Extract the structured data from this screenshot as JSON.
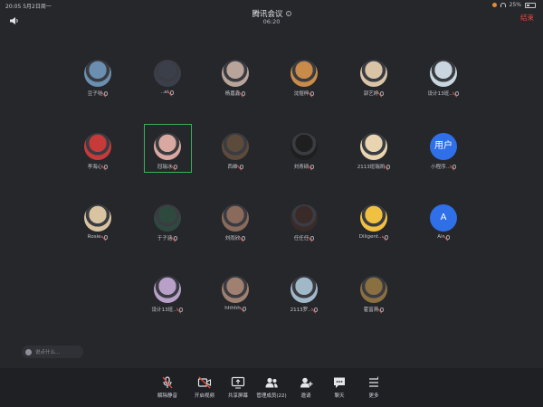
{
  "status_bar": {
    "time_date": "20:05  5月2日周一",
    "battery": "25%"
  },
  "header": {
    "title": "腾讯会议",
    "timer": "06:20",
    "end_label": "结束"
  },
  "participants": [
    {
      "name": "豆子哒",
      "avatar_color": "#6a8fb0",
      "avatar_text": ""
    },
    {
      "name": "..ai",
      "avatar_color": "#3a3f4a",
      "avatar_text": ""
    },
    {
      "name": "杨嘉鑫",
      "avatar_color": "#b9a49a",
      "avatar_text": ""
    },
    {
      "name": "沈煜梓",
      "avatar_color": "#c98b4a",
      "avatar_text": ""
    },
    {
      "name": "郭艺婷",
      "avatar_color": "#d9c4a8",
      "avatar_text": ""
    },
    {
      "name": "设计13班...",
      "avatar_color": "#c9d6df",
      "avatar_text": ""
    },
    {
      "name": "李海心",
      "avatar_color": "#c73a3a",
      "avatar_text": ""
    },
    {
      "name": "冠瑞冰",
      "avatar_color": "#d9a8a0",
      "avatar_text": ""
    },
    {
      "name": "西维",
      "avatar_color": "#5c4a3a",
      "avatar_text": ""
    },
    {
      "name": "刘青硕",
      "avatar_color": "#1f1f1f",
      "avatar_text": ""
    },
    {
      "name": "2113班瑞凯",
      "avatar_color": "#e8d4b0",
      "avatar_text": ""
    },
    {
      "name": "小程序...",
      "avatar_color": "#2f6fe8",
      "avatar_text": "用户"
    },
    {
      "name": "Rosie.",
      "avatar_color": "#d8c4a0",
      "avatar_text": ""
    },
    {
      "name": "于子涵",
      "avatar_color": "#2e4a3e",
      "avatar_text": ""
    },
    {
      "name": "刘雨欣",
      "avatar_color": "#8a6a5a",
      "avatar_text": ""
    },
    {
      "name": "任任任",
      "avatar_color": "#3a2a28",
      "avatar_text": ""
    },
    {
      "name": "Diligent...",
      "avatar_color": "#f0c040",
      "avatar_text": ""
    },
    {
      "name": "Air",
      "avatar_color": "#2f6fe8",
      "avatar_text": "A"
    },
    {
      "name": "设计13班...",
      "avatar_color": "#b9a0c8",
      "avatar_text": ""
    },
    {
      "name": "hhhhh",
      "avatar_color": "#a08070",
      "avatar_text": ""
    },
    {
      "name": "2113罗...",
      "avatar_color": "#a0b8c8",
      "avatar_text": ""
    },
    {
      "name": "霍富燕",
      "avatar_color": "#8a7040",
      "avatar_text": ""
    }
  ],
  "comment": {
    "placeholder": "说点什么..."
  },
  "toolbar": [
    {
      "label": "解除静音",
      "icon": "mic-off-icon"
    },
    {
      "label": "开启视频",
      "icon": "video-off-icon"
    },
    {
      "label": "共享屏幕",
      "icon": "share-screen-icon"
    },
    {
      "label": "管理成员(22)",
      "icon": "members-icon"
    },
    {
      "label": "邀请",
      "icon": "invite-icon"
    },
    {
      "label": "聊天",
      "icon": "chat-icon"
    },
    {
      "label": "更多",
      "icon": "more-icon"
    }
  ],
  "colors": {
    "background": "#25272b",
    "toolbar": "#1e2024",
    "end": "#e34a3e",
    "active_speaker": "#3dae5c",
    "letter_avatar": "#2f6fe8"
  }
}
